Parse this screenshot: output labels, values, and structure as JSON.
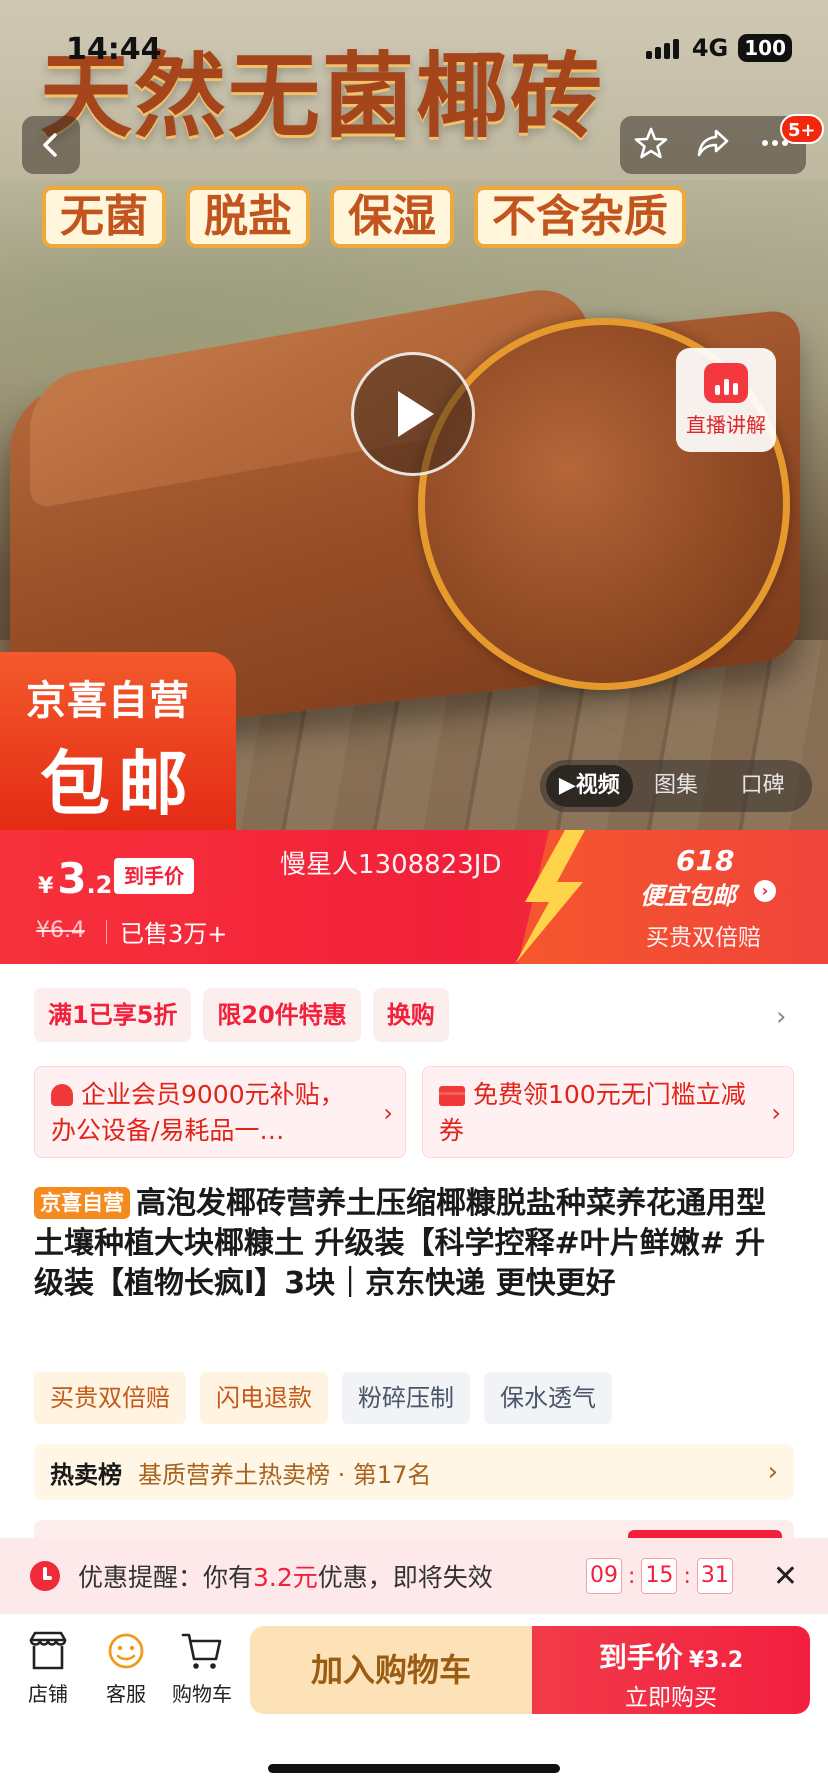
{
  "status_bar": {
    "time": "14:44",
    "network": "4G",
    "battery": "100"
  },
  "hero": {
    "title": "天然无菌椰砖",
    "tags": [
      "无菌",
      "脱盐",
      "保湿",
      "不含杂质"
    ],
    "badge_count": "5+",
    "live_label": "直播讲解",
    "self_operated_line1": "京喜自营",
    "self_operated_line2": "包邮",
    "media_tabs": [
      "▶视频",
      "图集",
      "口碑"
    ]
  },
  "price_banner": {
    "currency": "¥",
    "price_int": "3",
    "price_dec": ".2",
    "hand_price_label": "到手价",
    "original_price": "¥6.4",
    "sold": "已售3万+",
    "watermark": "慢星人1308823JD",
    "promo_618": "618",
    "promo_text": "便宜包邮",
    "double_comp": "买贵双倍赔"
  },
  "promos": [
    "满1已享5折",
    "限20件特惠",
    "换购"
  ],
  "coupons": [
    {
      "text": "企业会员9000元补贴，办公设备/易耗品一…"
    },
    {
      "text": "免费领100元无门槛立减券"
    }
  ],
  "product": {
    "tag": "京喜自营",
    "title": "高泡发椰砖营养土压缩椰糠脱盐种菜养花通用型土壤种植大块椰糠土 升级装【科学控释#叶片鲜嫩# 升级装【植物长疯l】3块｜京东快递 更快更好"
  },
  "services": [
    "买贵双倍赔",
    "闪电退款",
    "粉碎压制",
    "保水透气"
  ],
  "ranking": {
    "title": "热卖榜",
    "text": "基质营养土热卖榜 · 第17名"
  },
  "reminder": {
    "prefix": "优惠提醒：你有",
    "amount": "3.2元",
    "suffix": "优惠，即将失效",
    "hh": "09",
    "mm": "15",
    "ss": "31"
  },
  "bottom_bar": {
    "shop": "店铺",
    "service": "客服",
    "cart": "购物车",
    "add_to_cart": "加入购物车",
    "buy_price_label": "到手价",
    "buy_price": "¥3.2",
    "buy_now": "立即购买"
  },
  "colors": {
    "accent": "#f2203a",
    "orange": "#f58a1f",
    "cart_btn": "#fde2b8"
  }
}
